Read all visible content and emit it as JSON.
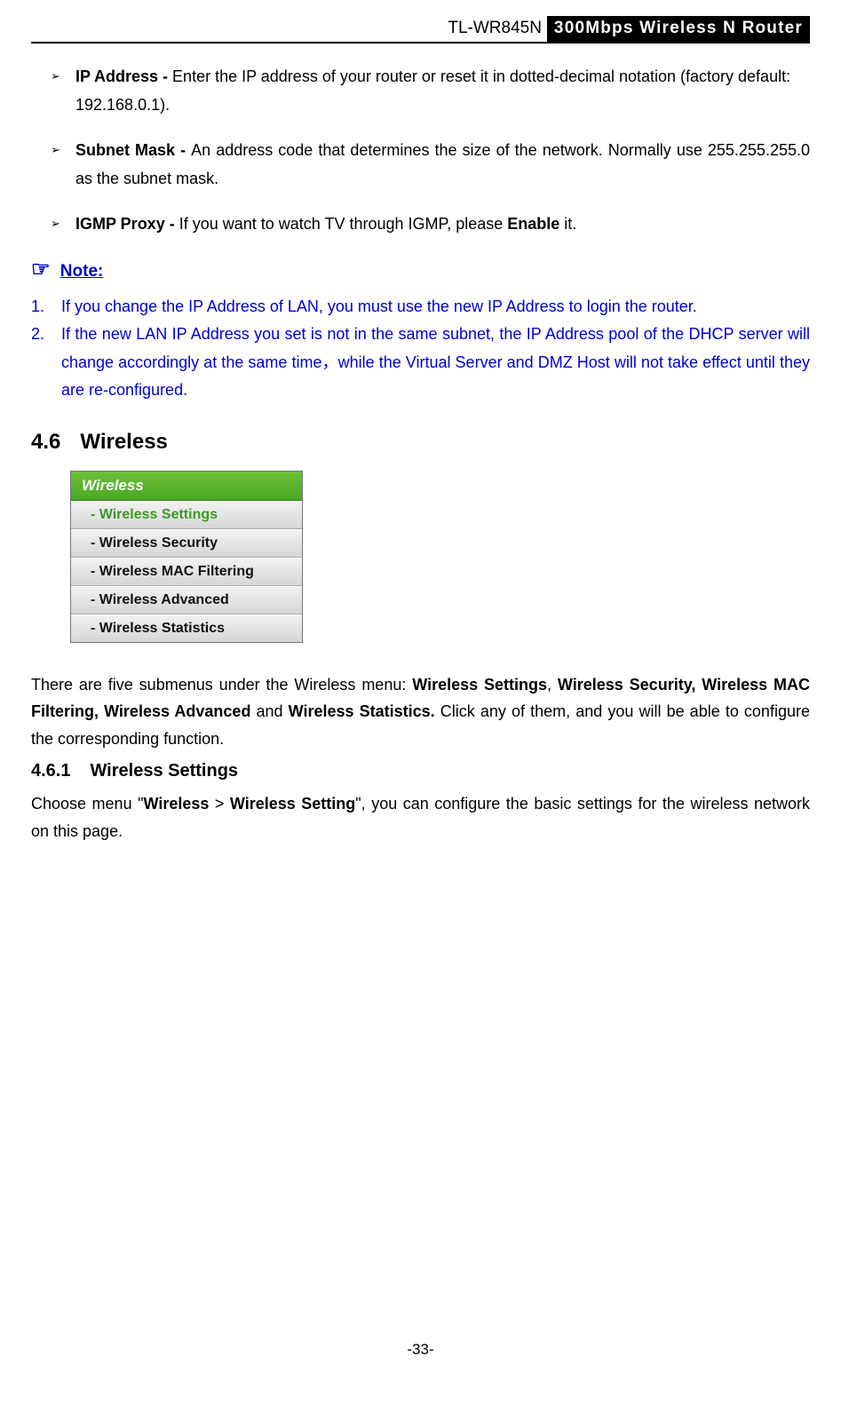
{
  "header": {
    "model": "TL-WR845N",
    "title": "300Mbps Wireless N Router"
  },
  "bullets": [
    {
      "label": "IP Address - ",
      "text": "Enter the IP address of your router or reset it in dotted-decimal notation (factory default: 192.168.0.1)."
    },
    {
      "label": "Subnet Mask - ",
      "text": "An address code that determines the size of the network. Normally use 255.255.255.0 as the subnet mask."
    },
    {
      "label": "IGMP Proxy - ",
      "text_pre": "If you want to watch TV through IGMP, please ",
      "text_bold": "Enable",
      "text_post": " it."
    }
  ],
  "note": {
    "label": "Note:",
    "items": [
      "If you change the IP Address of LAN, you must use the new IP Address to login the router.",
      "If the new LAN IP Address you set is not in the same subnet, the IP Address pool of the DHCP server will change accordingly at the same time，while the Virtual Server and DMZ Host will not take effect until they are re-configured."
    ]
  },
  "section": {
    "num": "4.6",
    "title": "Wireless"
  },
  "menu": {
    "header": "Wireless",
    "items": [
      "- Wireless Settings",
      "- Wireless Security",
      "- Wireless MAC Filtering",
      "- Wireless Advanced",
      "- Wireless Statistics"
    ]
  },
  "submenu_para": {
    "pre": "There are five submenus under the Wireless menu: ",
    "b1": "Wireless Settings",
    "sep1": ", ",
    "b2": "Wireless Security, Wireless MAC Filtering, Wireless Advanced",
    "mid": " and ",
    "b3": "Wireless Statistics.",
    "post": " Click any of them, and you will be able to configure the corresponding function."
  },
  "subsection": {
    "num": "4.6.1",
    "title": "Wireless Settings"
  },
  "sub_para": {
    "pre": "Choose menu \"",
    "b1": "Wireless",
    "mid1": " > ",
    "b2": "Wireless Setting",
    "post": "\", you can configure the basic settings for the wireless network on this page."
  },
  "page_num": "-33-"
}
